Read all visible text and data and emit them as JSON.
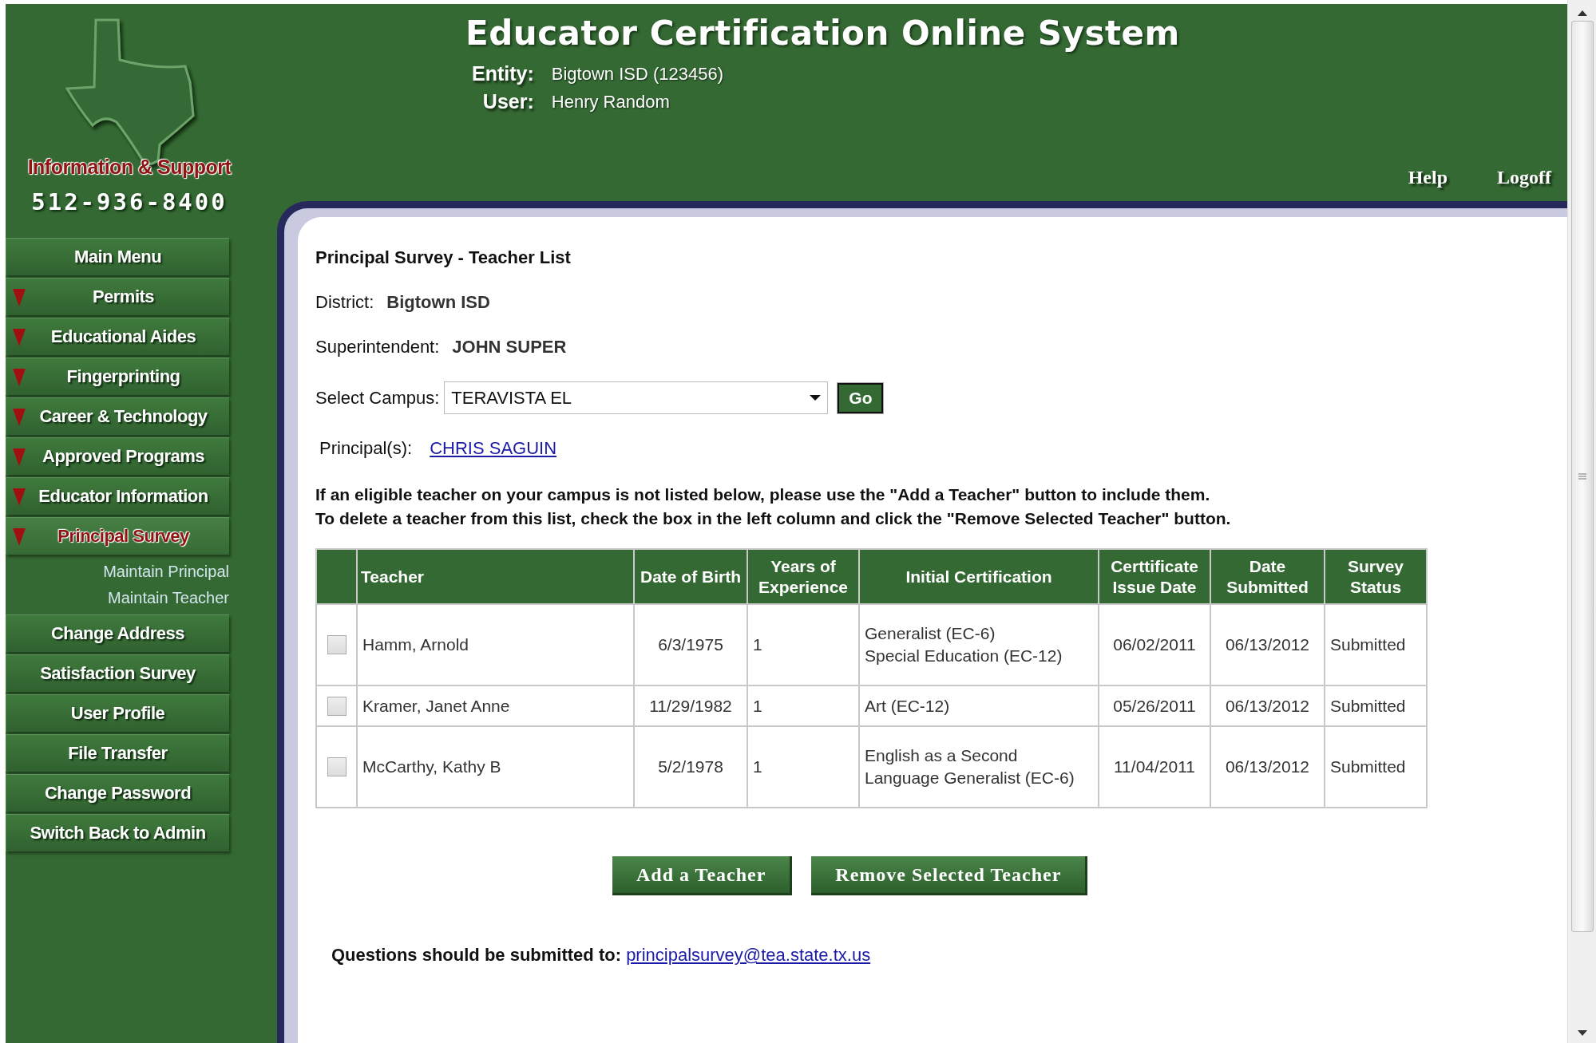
{
  "header": {
    "title": "Educator Certification Online System",
    "entity_label": "Entity:",
    "entity": "Bigtown ISD (123456)",
    "user_label": "User:",
    "user": "Henry Random",
    "links": [
      "Help",
      "Logoff"
    ]
  },
  "support": {
    "label": "Information & Support",
    "phone": "512-936-8400"
  },
  "sidebar": {
    "items": [
      {
        "label": "Main Menu",
        "kind": "link",
        "selected": false
      },
      {
        "label": "Permits",
        "kind": "menu",
        "selected": false
      },
      {
        "label": "Educational Aides",
        "kind": "menu",
        "selected": false
      },
      {
        "label": "Fingerprinting",
        "kind": "menu",
        "selected": false
      },
      {
        "label": "Career & Technology",
        "kind": "menu",
        "selected": false
      },
      {
        "label": "Approved Programs",
        "kind": "menu",
        "selected": false
      },
      {
        "label": "Educator Information",
        "kind": "menu",
        "selected": false
      },
      {
        "label": "Principal Survey",
        "kind": "menu",
        "selected": true,
        "children": [
          {
            "label": "Maintain Principal"
          },
          {
            "label": "Maintain Teacher"
          }
        ]
      },
      {
        "label": "Change Address",
        "kind": "link",
        "selected": false
      },
      {
        "label": "Satisfaction Survey",
        "kind": "link",
        "selected": false
      },
      {
        "label": "User Profile",
        "kind": "link",
        "selected": false
      },
      {
        "label": "File Transfer",
        "kind": "link",
        "selected": false
      },
      {
        "label": "Change Password",
        "kind": "link",
        "selected": false
      },
      {
        "label": "Switch Back to Admin",
        "kind": "link",
        "selected": false
      }
    ]
  },
  "content": {
    "title": "Principal Survey - Teacher List",
    "district_label": "District:",
    "district": "Bigtown ISD",
    "superintendent_label": "Superintendent:",
    "superintendent": "JOHN SUPER",
    "campus_label": "Select Campus:",
    "campus": "TERAVISTA EL",
    "go_button": "Go",
    "principals_label": "Principal(s):",
    "principal": "CHRIS SAGUIN",
    "instructions": [
      "If an eligible teacher on your campus is not listed below, please use the \"Add a Teacher\" button to include them.",
      "To delete a teacher from this list, check the box in the left column and click the \"Remove Selected Teacher\" button."
    ]
  },
  "table": {
    "columns": [
      "Teacher",
      "Date of Birth",
      "Years of Experience",
      "Initial Certification",
      "Certtificate Issue Date",
      "Date Submitted",
      "Survey Status"
    ],
    "rows": [
      {
        "checked": false,
        "teacher": "Hamm, Arnold",
        "birth": "6/3/1975",
        "years": "1",
        "certification": [
          "Generalist (EC-6)",
          "Special Education (EC-12)"
        ],
        "issue_date": "06/02/2011",
        "submitted": "06/13/2012",
        "status": "Submitted"
      },
      {
        "checked": false,
        "teacher": "Kramer, Janet Anne",
        "birth": "11/29/1982",
        "years": "1",
        "certification": [
          "Art (EC-12)"
        ],
        "issue_date": "05/26/2011",
        "submitted": "06/13/2012",
        "status": "Submitted"
      },
      {
        "checked": false,
        "teacher": "McCarthy, Kathy B",
        "birth": "5/2/1978",
        "years": "1",
        "certification": [
          "English as a Second Language Generalist (EC-6)"
        ],
        "issue_date": "11/04/2011",
        "submitted": "06/13/2012",
        "status": "Submitted"
      }
    ]
  },
  "buttons": [
    "Add a Teacher",
    "Remove Selected Teacher"
  ],
  "footer": {
    "text": "Questions should be submitted to:",
    "email": "principalsurvey@tea.state.tx.us"
  }
}
